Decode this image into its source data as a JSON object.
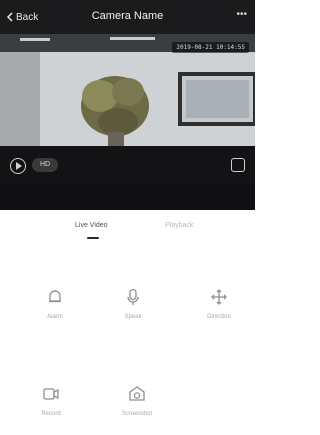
{
  "header": {
    "back_label": "Back",
    "title": "Camera Name",
    "more_label": "•••"
  },
  "video": {
    "timestamp": "2019-08-21 10:14:55",
    "quality_label": "HD"
  },
  "tabs": [
    {
      "label": "Live Video"
    },
    {
      "label": "Playback"
    }
  ],
  "functions": [
    {
      "label": "Alarm",
      "icon": "bell-icon"
    },
    {
      "label": "Speak",
      "icon": "microphone-icon"
    },
    {
      "label": "Direction",
      "icon": "direction-pad-icon"
    },
    {
      "label": "Record",
      "icon": "video-record-icon"
    },
    {
      "label": "Screenshot",
      "icon": "camera-icon"
    }
  ],
  "colors": {
    "header_bg": "#1b1b1d",
    "strip_bg": "#0f0f11",
    "accent_text": "#505050"
  }
}
